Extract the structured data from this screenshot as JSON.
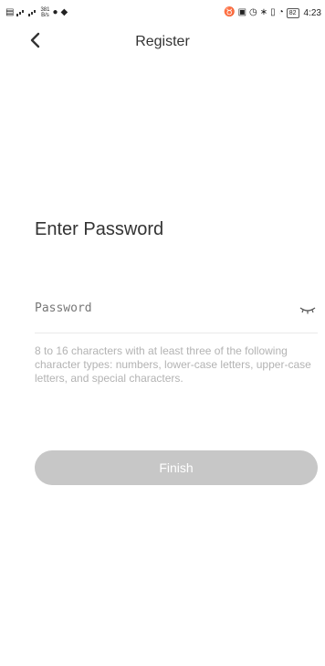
{
  "status_bar": {
    "speed_value": "381",
    "speed_unit": "B/s",
    "battery": "82",
    "time": "4:23"
  },
  "header": {
    "title": "Register"
  },
  "main": {
    "heading": "Enter Password",
    "password_placeholder": "Password",
    "hint": "8 to 16 characters with at least three of the following character types: numbers, lower-case letters, upper-case letters, and special characters.",
    "finish_label": "Finish"
  }
}
